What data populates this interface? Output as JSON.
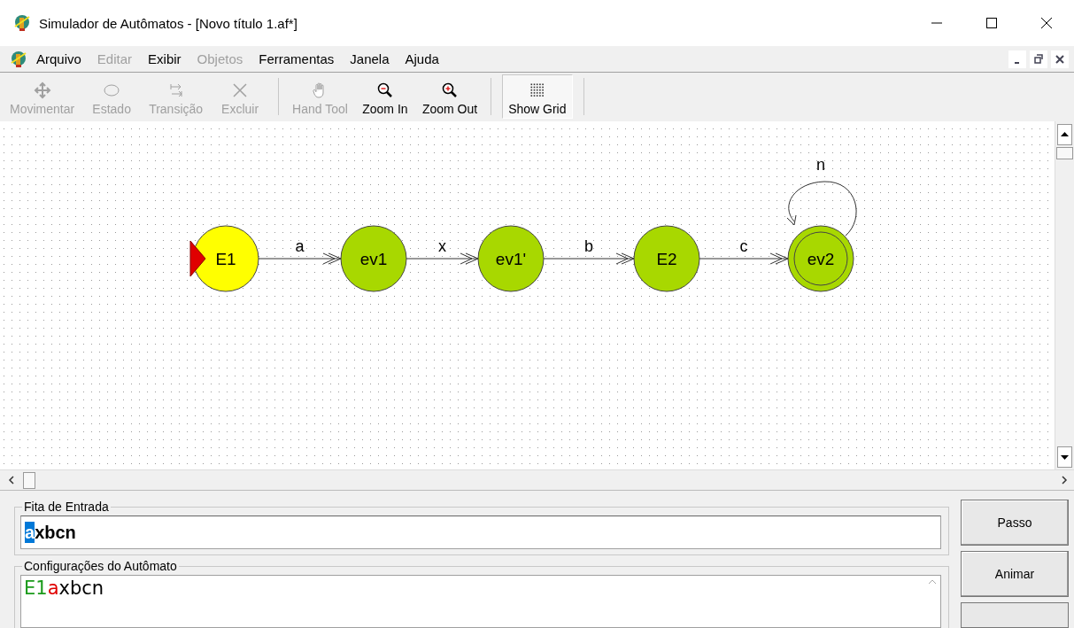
{
  "window": {
    "title": "Simulador de Autômatos - [Novo título 1.af*]"
  },
  "menu": [
    {
      "label": "Arquivo",
      "disabled": false
    },
    {
      "label": "Editar",
      "disabled": true
    },
    {
      "label": "Exibir",
      "disabled": false
    },
    {
      "label": "Objetos",
      "disabled": true
    },
    {
      "label": "Ferramentas",
      "disabled": false
    },
    {
      "label": "Janela",
      "disabled": false
    },
    {
      "label": "Ajuda",
      "disabled": false
    }
  ],
  "toolbar": [
    {
      "kind": "move",
      "label": "Movimentar",
      "disabled": true,
      "selected": false
    },
    {
      "kind": "state",
      "label": "Estado",
      "disabled": true,
      "selected": false
    },
    {
      "kind": "transition",
      "label": "Transição",
      "disabled": true,
      "selected": false
    },
    {
      "kind": "delete",
      "label": "Excluir",
      "disabled": true,
      "selected": false
    },
    {
      "kind": "hand",
      "label": "Hand Tool",
      "disabled": true,
      "selected": false
    },
    {
      "kind": "zoom_in",
      "label": "Zoom In",
      "disabled": false,
      "selected": false
    },
    {
      "kind": "zoom_out",
      "label": "Zoom Out",
      "disabled": false,
      "selected": false
    },
    {
      "kind": "grid",
      "label": "Show Grid",
      "disabled": false,
      "selected": true
    }
  ],
  "states": [
    {
      "label": "E1",
      "current": true,
      "initial": true,
      "final": false,
      "transitions": [
        {
          "label": "a",
          "kind": "chain"
        }
      ]
    },
    {
      "label": "ev1",
      "current": false,
      "initial": false,
      "final": false,
      "transitions": [
        {
          "label": "x",
          "kind": "chain"
        }
      ]
    },
    {
      "label": "ev1'",
      "current": false,
      "initial": false,
      "final": false,
      "transitions": [
        {
          "label": "b",
          "kind": "chain"
        }
      ]
    },
    {
      "label": "E2",
      "current": false,
      "initial": false,
      "final": false,
      "transitions": [
        {
          "label": "c",
          "kind": "chain"
        }
      ]
    },
    {
      "label": "ev2",
      "current": false,
      "initial": false,
      "final": true,
      "transitions": [
        {
          "label": "n",
          "kind": "loop"
        }
      ]
    }
  ],
  "input_tape": {
    "legend": "Fita de Entrada",
    "head": "a",
    "rest": "xbcn"
  },
  "configuration": {
    "legend": "Configurações do Autômato",
    "state": "E1",
    "symbol": "a",
    "remaining": "xbcn"
  },
  "buttons": [
    {
      "label": "Passo"
    },
    {
      "label": "Animar"
    }
  ]
}
